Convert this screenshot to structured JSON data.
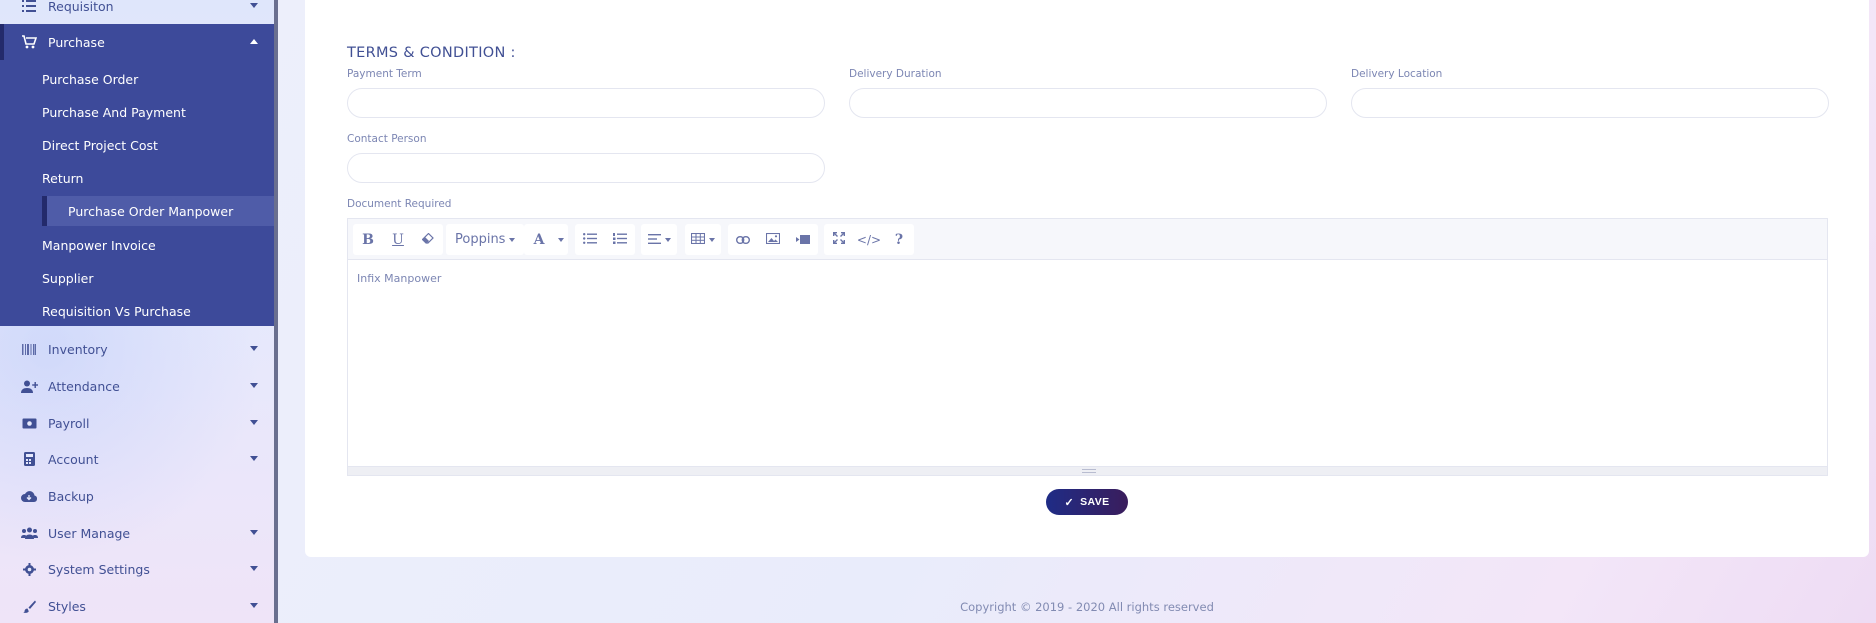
{
  "sidebar": {
    "items": [
      {
        "label": "Requisiton",
        "icon": "list-icon"
      },
      {
        "label": "Purchase",
        "icon": "cart-icon"
      },
      {
        "label": "Inventory",
        "icon": "barcode-icon"
      },
      {
        "label": "Attendance",
        "icon": "user-plus-icon"
      },
      {
        "label": "Payroll",
        "icon": "money-icon"
      },
      {
        "label": "Account",
        "icon": "calculator-icon"
      },
      {
        "label": "Backup",
        "icon": "cloud-download-icon"
      },
      {
        "label": "User Manage",
        "icon": "users-icon"
      },
      {
        "label": "System Settings",
        "icon": "gear-icon"
      },
      {
        "label": "Styles",
        "icon": "brush-icon"
      }
    ],
    "purchase_submenu": [
      "Purchase Order",
      "Purchase And Payment",
      "Direct Project Cost",
      "Return",
      "Purchase Order Manpower",
      "Manpower Invoice",
      "Supplier",
      "Requisition Vs Purchase"
    ],
    "active_subitem": "Purchase Order Manpower"
  },
  "form": {
    "section_title": "TERMS & CONDITION :",
    "payment_term_label": "Payment Term",
    "payment_term_value": "",
    "delivery_duration_label": "Delivery Duration",
    "delivery_duration_value": "",
    "delivery_location_label": "Delivery Location",
    "delivery_location_value": "",
    "contact_person_label": "Contact Person",
    "contact_person_value": "",
    "document_required_label": "Document Required",
    "editor_font": "Poppins",
    "editor_content": "Infix Manpower",
    "save_label": "SAVE"
  },
  "footer": {
    "copyright": "Copyright © 2019 - 2020 All rights reserved"
  },
  "colors": {
    "accent": "#3d4a9a",
    "text": "#415094",
    "button_start": "#1f2c86",
    "button_end": "#3a1d5c"
  }
}
